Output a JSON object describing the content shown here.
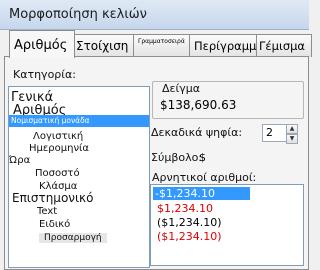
{
  "window": {
    "title": "Μορφοποίηση κελιών"
  },
  "tabs": [
    {
      "label": "Αριθμός",
      "active": true
    },
    {
      "label": "Στοίχιση",
      "active": false
    },
    {
      "label": "Γραμματοσειρά",
      "active": false
    },
    {
      "label": "Περίγραμμα",
      "active": false
    },
    {
      "label": "Γέμισμα",
      "active": false
    }
  ],
  "category": {
    "label": "Κατηγορία:",
    "items": [
      "Γενικά",
      "Αριθμός",
      "Νομισματική μονάδα",
      "Λογιστική",
      "Ημερομηνία",
      "Ώρα",
      "Ποσοστό",
      "Κλάσμα",
      "Επιστημονικό",
      "Text",
      "Ειδικό",
      "Προσαρμογή"
    ],
    "selected": "Νομισματική μονάδα"
  },
  "sample": {
    "label": "Δείγμα",
    "value": "$138,690.63"
  },
  "decimals": {
    "label": "Δεκαδικά ψηφία:",
    "value": "2"
  },
  "symbol": {
    "label": "Σύμβολο:",
    "value": "$"
  },
  "negative": {
    "label": "Αρνητικοί αριθμοί:",
    "items": [
      {
        "text": "-$1,234.10",
        "color": "#ffffff",
        "selected": true
      },
      {
        "text": "$1,234.10",
        "color": "#e00000",
        "selected": false
      },
      {
        "text": "($1,234.10)",
        "color": "#000000",
        "selected": false
      },
      {
        "text": "($1,234.10)",
        "color": "#e00000",
        "selected": false
      }
    ]
  }
}
